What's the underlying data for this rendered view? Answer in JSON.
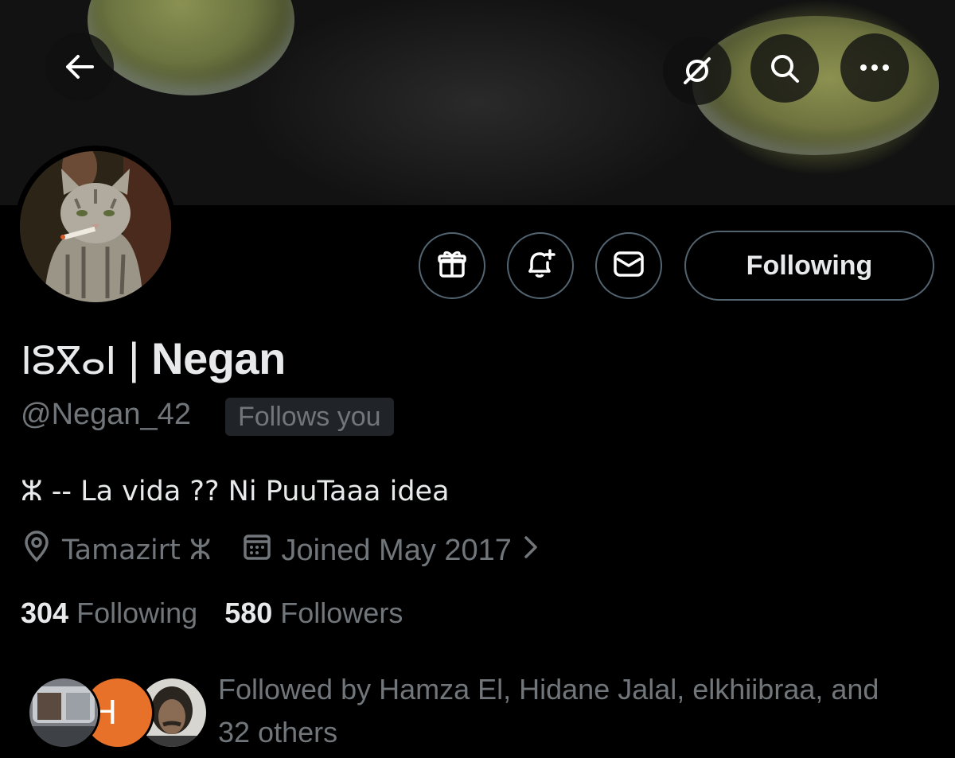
{
  "header": {
    "back_icon": "arrow-left-icon",
    "grok_icon": "grok-icon",
    "search_icon": "search-icon",
    "more_icon": "more-horizontal-icon"
  },
  "actions": {
    "gift_icon": "gift-icon",
    "notify_icon": "bell-plus-icon",
    "message_icon": "envelope-icon",
    "following_label": "Following"
  },
  "profile": {
    "name_tifinagh": "ⵏⵓⴳⴰⵏ",
    "name_sep": " | ",
    "name": "Negan",
    "handle": "@Negan_42",
    "follows_you": "Follows you",
    "bio": "ⵣ -- La vida ?? Ni PuuTaaa idea",
    "location": "Tamazirt ⵣ",
    "joined": "Joined May 2017"
  },
  "stats": {
    "following_count": "304",
    "following_label": "Following",
    "followers_count": "580",
    "followers_label": "Followers"
  },
  "followed_by": {
    "text": "Followed by Hamza El, Hidane Jalal, elkhiibraa, and 32 others",
    "avatar_letter": "H"
  },
  "colors": {
    "background": "#000000",
    "primary_text": "#e7e9ea",
    "secondary_text": "#71767b",
    "border": "#536471",
    "badge_bg": "#202327",
    "avatar_orange": "#e8712a"
  }
}
